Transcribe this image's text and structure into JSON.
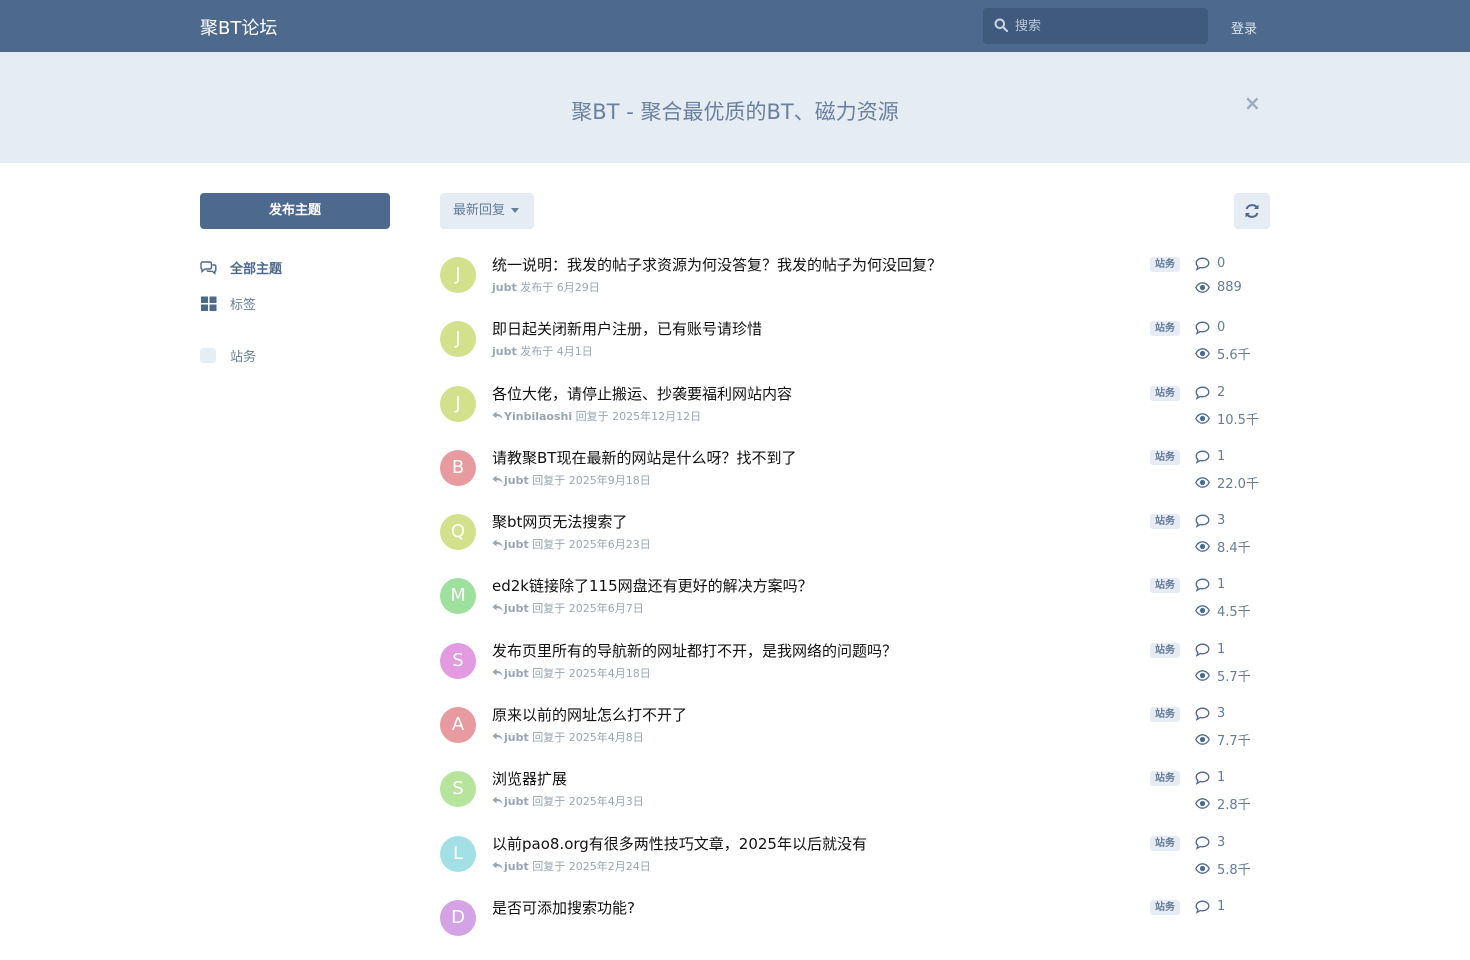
{
  "header": {
    "brand": "聚BT论坛",
    "search_placeholder": "搜索",
    "login": "登录"
  },
  "hero": {
    "text": "聚BT - 聚合最优质的BT、磁力资源",
    "close": "×"
  },
  "sidebar": {
    "new_discussion": "发布主题",
    "items": [
      {
        "label": "全部主题",
        "icon": "comments-icon"
      },
      {
        "label": "标签",
        "icon": "tags-grid-icon"
      },
      {
        "label": "站务",
        "icon": "tag-square-icon"
      }
    ]
  },
  "toolbar": {
    "sort_label": "最新回复",
    "refresh_icon": "refresh-icon"
  },
  "colors": {
    "primary": "#4d698e",
    "hero_bg": "#e6ecf4",
    "muted": "#667c99"
  },
  "discussions": [
    {
      "avatar": "J",
      "avatar_color": "#d4e18c",
      "title": "统一说明：我发的帖子求资源为何没答复？我发的帖子为何没回复？",
      "user": "jubt",
      "action": "发布于",
      "date": "6月29日",
      "is_reply": false,
      "tag": "站务",
      "replies": "0",
      "views": "889"
    },
    {
      "avatar": "J",
      "avatar_color": "#d4e18c",
      "title": "即日起关闭新用户注册，已有账号请珍惜",
      "user": "jubt",
      "action": "发布于",
      "date": "4月1日",
      "is_reply": false,
      "tag": "站务",
      "replies": "0",
      "views": "5.6千"
    },
    {
      "avatar": "J",
      "avatar_color": "#d4e18c",
      "title": "各位大佬，请停止搬运、抄袭要福利网站内容",
      "user": "Yinbilaoshi",
      "action": "回复于",
      "date": "2025年12月12日",
      "is_reply": true,
      "tag": "站务",
      "replies": "2",
      "views": "10.5千"
    },
    {
      "avatar": "B",
      "avatar_color": "#e79a9f",
      "title": "请教聚BT现在最新的网站是什么呀？找不到了",
      "user": "jubt",
      "action": "回复于",
      "date": "2025年9月18日",
      "is_reply": true,
      "tag": "站务",
      "replies": "1",
      "views": "22.0千"
    },
    {
      "avatar": "Q",
      "avatar_color": "#d4e18c",
      "title": "聚bt网页无法搜索了",
      "user": "jubt",
      "action": "回复于",
      "date": "2025年6月23日",
      "is_reply": true,
      "tag": "站务",
      "replies": "3",
      "views": "8.4千"
    },
    {
      "avatar": "M",
      "avatar_color": "#9ee09e",
      "title": "ed2k链接除了115网盘还有更好的解决方案吗？",
      "user": "jubt",
      "action": "回复于",
      "date": "2025年6月7日",
      "is_reply": true,
      "tag": "站务",
      "replies": "1",
      "views": "4.5千"
    },
    {
      "avatar": "S",
      "avatar_color": "#e29be0",
      "title": "发布页里所有的导航新的网址都打不开，是我网络的问题吗？",
      "user": "jubt",
      "action": "回复于",
      "date": "2025年4月18日",
      "is_reply": true,
      "tag": "站务",
      "replies": "1",
      "views": "5.7千"
    },
    {
      "avatar": "A",
      "avatar_color": "#e79a9f",
      "title": "原来以前的网址怎么打不开了",
      "user": "jubt",
      "action": "回复于",
      "date": "2025年4月8日",
      "is_reply": true,
      "tag": "站务",
      "replies": "3",
      "views": "7.7千"
    },
    {
      "avatar": "S",
      "avatar_color": "#b6e49c",
      "title": "浏览器扩展",
      "user": "jubt",
      "action": "回复于",
      "date": "2025年4月3日",
      "is_reply": true,
      "tag": "站务",
      "replies": "1",
      "views": "2.8千"
    },
    {
      "avatar": "L",
      "avatar_color": "#a3e0e6",
      "title": "以前pao8.org有很多两性技巧文章，2025年以后就没有",
      "user": "jubt",
      "action": "回复于",
      "date": "2025年2月24日",
      "is_reply": true,
      "tag": "站务",
      "replies": "3",
      "views": "5.8千"
    },
    {
      "avatar": "D",
      "avatar_color": "#d3a3e6",
      "title": "是否可添加搜索功能?",
      "user": "",
      "action": "",
      "date": "",
      "is_reply": false,
      "tag": "站务",
      "replies": "1",
      "views": ""
    }
  ]
}
